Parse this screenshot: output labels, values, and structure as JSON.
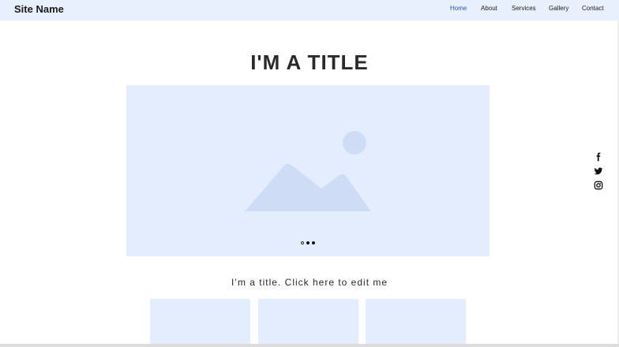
{
  "header": {
    "site_name": "Site Name",
    "nav": [
      {
        "label": "Home",
        "active": true
      },
      {
        "label": "About",
        "active": false
      },
      {
        "label": "Services",
        "active": false
      },
      {
        "label": "Gallery",
        "active": false
      },
      {
        "label": "Contact",
        "active": false
      }
    ]
  },
  "main": {
    "title": "I'M A TITLE",
    "subtitle": "I’m a title. Click here to edit me",
    "slideshow": {
      "dots": [
        {
          "active": false
        },
        {
          "active": true
        },
        {
          "active": true
        }
      ]
    }
  },
  "social": [
    {
      "icon": "facebook-icon"
    },
    {
      "icon": "twitter-icon"
    },
    {
      "icon": "instagram-icon"
    }
  ],
  "colors": {
    "header_bg": "#e8effd",
    "placeholder_bg": "#e4edfd",
    "placeholder_shape": "#cfdcf6",
    "nav_active": "#1c5fb0"
  }
}
